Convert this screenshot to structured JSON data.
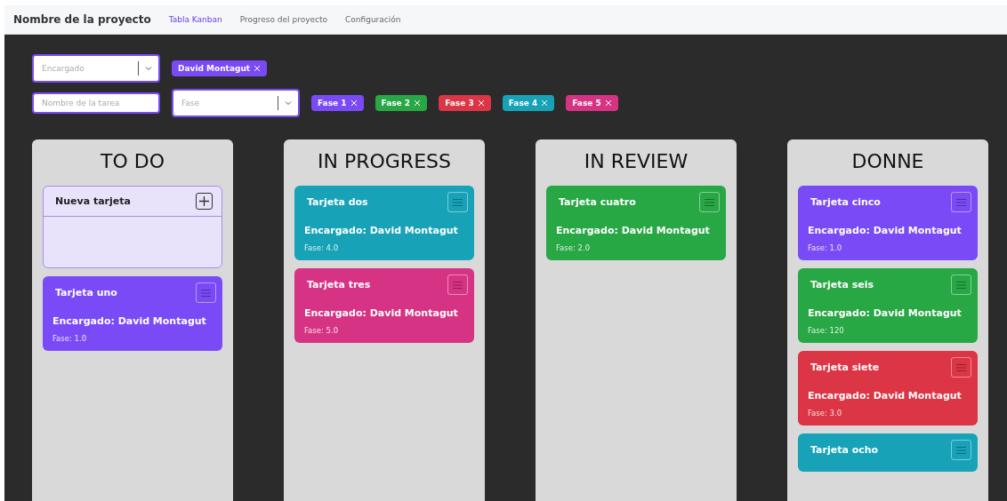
{
  "nav": {
    "title": "Nombre de la proyecto",
    "links": [
      {
        "label": "Tabla Kanban",
        "selected": true
      },
      {
        "label": "Progreso del proyecto",
        "selected": false
      },
      {
        "label": "Configuración",
        "selected": false
      }
    ]
  },
  "filters": {
    "assignee_select": {
      "placeholder": "Encargado"
    },
    "assignee_chips": [
      {
        "label": "David Montagut",
        "color": "#7a4af7"
      }
    ],
    "task_field": {
      "placeholder": "Nombre de la tarea"
    },
    "phase_select": {
      "placeholder": "Fase"
    },
    "phase_chips": [
      {
        "label": "Fase 1",
        "color": "#7a4af7"
      },
      {
        "label": "Fase 2",
        "color": "#28a745"
      },
      {
        "label": "Fase 3",
        "color": "#dc3545"
      },
      {
        "label": "Fase 4",
        "color": "#17a2b8"
      },
      {
        "label": "Fase 5",
        "color": "#d63384"
      }
    ]
  },
  "columns": [
    {
      "title": "TO DO",
      "new_card": {
        "title": "Nueva tarjeta"
      },
      "cards": [
        {
          "title": "Tarjeta uno",
          "assignee": "Encargado: David Montagut",
          "phase": "Fase: 1.0",
          "color": "#7a4af7"
        }
      ]
    },
    {
      "title": "IN PROGRESS",
      "cards": [
        {
          "title": "Tarjeta dos",
          "assignee": "Encargado: David Montagut",
          "phase": "Fase: 4.0",
          "color": "#17a2b8"
        },
        {
          "title": "Tarjeta tres",
          "assignee": "Encargado: David Montagut",
          "phase": "Fase: 5.0",
          "color": "#d63384"
        }
      ]
    },
    {
      "title": "IN REVIEW",
      "cards": [
        {
          "title": "Tarjeta cuatro",
          "assignee": "Encargado: David Montagut",
          "phase": "Fase: 2.0",
          "color": "#28a745"
        }
      ]
    },
    {
      "title": "DONNE",
      "cards": [
        {
          "title": "Tarjeta cinco",
          "assignee": "Encargado: David Montagut",
          "phase": "Fase: 1.0",
          "color": "#7a4af7"
        },
        {
          "title": "Tarjeta seis",
          "assignee": "Encargado: David Montagut",
          "phase": "Fase: 120",
          "color": "#28a745"
        },
        {
          "title": "Tarjeta siete",
          "assignee": "Encargado: David Montagut",
          "phase": "Fase: 3.0",
          "color": "#dc3545"
        },
        {
          "title": "Tarjeta ocho",
          "color": "#17a2b8"
        }
      ]
    }
  ]
}
